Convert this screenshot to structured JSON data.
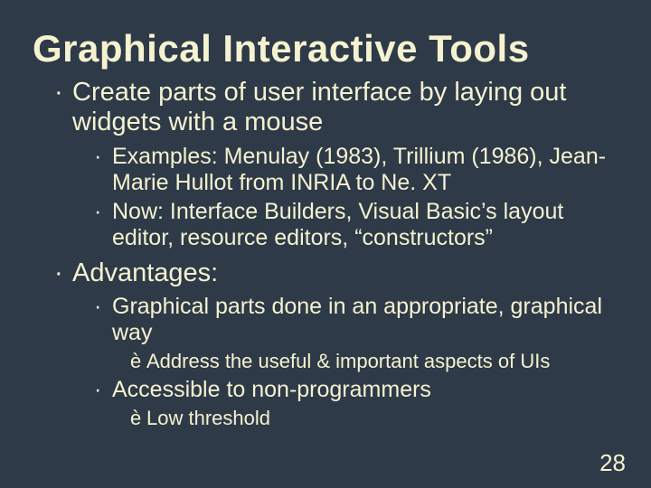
{
  "title": "Graphical Interactive Tools",
  "bullets": {
    "b1": "Create parts of user interface by laying out widgets with a mouse",
    "b1a": "Examples: Menulay (1983), Trillium (1986), Jean-Marie Hullot from INRIA to Ne. XT",
    "b1b": "Now: Interface Builders, Visual Basic’s layout editor, resource editors, “constructors”",
    "b2": "Advantages:",
    "b2a": "Graphical parts done in an appropriate, graphical way",
    "b2a1": "Address the useful & important aspects of UIs",
    "b2b": "Accessible to non-programmers",
    "b2b1": "Low threshold"
  },
  "glyphs": {
    "dot": "·",
    "arrow": "è"
  },
  "page_number": "28"
}
